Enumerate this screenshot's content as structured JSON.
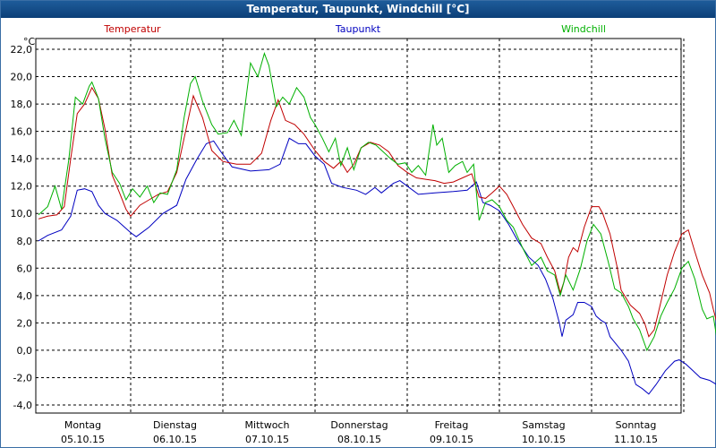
{
  "window": {
    "title": "Temperatur, Taupunkt, Windchill [°C]"
  },
  "chart_data": {
    "type": "line",
    "title": "Temperatur, Taupunkt, Windchill [°C]",
    "unit": "°C",
    "ylim": [
      -4.0,
      22.0
    ],
    "y_ticks": [
      "22,0",
      "20,0",
      "18,0",
      "16,0",
      "14,0",
      "12,0",
      "10,0",
      "8,0",
      "6,0",
      "4,0",
      "2,0",
      "0,0",
      "-2,0",
      "-4,0"
    ],
    "x_range_days": [
      0,
      7.2
    ],
    "x_ticks": [
      {
        "day": "Montag",
        "date": "05.10.15"
      },
      {
        "day": "Dienstag",
        "date": "06.10.15"
      },
      {
        "day": "Mittwoch",
        "date": "07.10.15"
      },
      {
        "day": "Donnerstag",
        "date": "08.10.15"
      },
      {
        "day": "Freitag",
        "date": "09.10.15"
      },
      {
        "day": "Samstag",
        "date": "10.10.15"
      },
      {
        "day": "Sonntag",
        "date": "11.10.15"
      }
    ],
    "grid": true,
    "series": [
      {
        "name": "Taupunkt",
        "color": "#0000c0",
        "points": [
          [
            0,
            8.0
          ],
          [
            0.1,
            8.4
          ],
          [
            0.25,
            8.8
          ],
          [
            0.35,
            9.8
          ],
          [
            0.42,
            11.7
          ],
          [
            0.5,
            11.8
          ],
          [
            0.58,
            11.6
          ],
          [
            0.65,
            10.6
          ],
          [
            0.72,
            10.0
          ],
          [
            0.85,
            9.5
          ],
          [
            1.0,
            8.6
          ],
          [
            1.06,
            8.3
          ],
          [
            1.2,
            9.0
          ],
          [
            1.35,
            10.0
          ],
          [
            1.5,
            10.6
          ],
          [
            1.6,
            12.5
          ],
          [
            1.72,
            14.0
          ],
          [
            1.82,
            15.1
          ],
          [
            1.9,
            15.3
          ],
          [
            1.98,
            14.5
          ],
          [
            2.1,
            13.4
          ],
          [
            2.3,
            13.1
          ],
          [
            2.5,
            13.2
          ],
          [
            2.62,
            13.6
          ],
          [
            2.72,
            15.5
          ],
          [
            2.82,
            15.1
          ],
          [
            2.9,
            15.1
          ],
          [
            3.0,
            14.2
          ],
          [
            3.1,
            13.6
          ],
          [
            3.18,
            12.2
          ],
          [
            3.3,
            11.9
          ],
          [
            3.45,
            11.7
          ],
          [
            3.55,
            11.4
          ],
          [
            3.65,
            11.9
          ],
          [
            3.72,
            11.5
          ],
          [
            3.85,
            12.2
          ],
          [
            3.92,
            12.4
          ],
          [
            4.0,
            12.0
          ],
          [
            4.12,
            11.4
          ],
          [
            4.3,
            11.5
          ],
          [
            4.5,
            11.6
          ],
          [
            4.65,
            11.7
          ],
          [
            4.75,
            12.3
          ],
          [
            4.82,
            10.8
          ],
          [
            4.9,
            10.6
          ],
          [
            5.0,
            10.2
          ],
          [
            5.1,
            9.2
          ],
          [
            5.2,
            8.0
          ],
          [
            5.32,
            6.8
          ],
          [
            5.42,
            6.2
          ],
          [
            5.5,
            5.2
          ],
          [
            5.58,
            3.8
          ],
          [
            5.65,
            2.0
          ],
          [
            5.68,
            1.0
          ],
          [
            5.72,
            2.2
          ],
          [
            5.8,
            2.6
          ],
          [
            5.85,
            3.5
          ],
          [
            5.92,
            3.5
          ],
          [
            6.0,
            3.2
          ],
          [
            6.05,
            2.5
          ],
          [
            6.1,
            2.2
          ],
          [
            6.15,
            2.0
          ],
          [
            6.2,
            1.0
          ],
          [
            6.32,
            0.0
          ],
          [
            6.4,
            -0.8
          ],
          [
            6.48,
            -2.5
          ],
          [
            6.55,
            -2.8
          ],
          [
            6.62,
            -3.2
          ],
          [
            6.7,
            -2.5
          ],
          [
            6.8,
            -1.5
          ],
          [
            6.9,
            -0.8
          ],
          [
            6.95,
            -0.7
          ],
          [
            7.02,
            -1.0
          ],
          [
            7.1,
            -1.5
          ],
          [
            7.18,
            -2.0
          ],
          [
            7.28,
            -2.2
          ],
          [
            7.38,
            -2.6
          ]
        ]
      },
      {
        "name": "Temperatur",
        "color": "#c00000",
        "points": [
          [
            0,
            9.6
          ],
          [
            0.1,
            9.8
          ],
          [
            0.2,
            9.9
          ],
          [
            0.28,
            10.5
          ],
          [
            0.35,
            14.0
          ],
          [
            0.42,
            17.3
          ],
          [
            0.5,
            18.0
          ],
          [
            0.58,
            19.2
          ],
          [
            0.65,
            18.4
          ],
          [
            0.72,
            16.2
          ],
          [
            0.8,
            12.8
          ],
          [
            0.88,
            11.5
          ],
          [
            0.95,
            10.3
          ],
          [
            1.0,
            9.8
          ],
          [
            1.1,
            10.6
          ],
          [
            1.2,
            11.0
          ],
          [
            1.3,
            11.4
          ],
          [
            1.4,
            11.6
          ],
          [
            1.5,
            13.0
          ],
          [
            1.58,
            15.5
          ],
          [
            1.68,
            18.6
          ],
          [
            1.78,
            17.0
          ],
          [
            1.88,
            14.6
          ],
          [
            2.0,
            13.8
          ],
          [
            2.15,
            13.6
          ],
          [
            2.3,
            13.6
          ],
          [
            2.42,
            14.4
          ],
          [
            2.52,
            16.8
          ],
          [
            2.6,
            18.3
          ],
          [
            2.68,
            16.8
          ],
          [
            2.78,
            16.5
          ],
          [
            2.88,
            15.8
          ],
          [
            3.0,
            14.6
          ],
          [
            3.1,
            13.8
          ],
          [
            3.2,
            13.3
          ],
          [
            3.28,
            13.8
          ],
          [
            3.35,
            13.0
          ],
          [
            3.42,
            13.6
          ],
          [
            3.5,
            14.8
          ],
          [
            3.6,
            15.2
          ],
          [
            3.7,
            15.0
          ],
          [
            3.8,
            14.5
          ],
          [
            3.9,
            13.5
          ],
          [
            4.0,
            13.0
          ],
          [
            4.1,
            12.6
          ],
          [
            4.2,
            12.5
          ],
          [
            4.3,
            12.4
          ],
          [
            4.4,
            12.2
          ],
          [
            4.5,
            12.3
          ],
          [
            4.6,
            12.6
          ],
          [
            4.7,
            12.9
          ],
          [
            4.78,
            11.2
          ],
          [
            4.85,
            11.1
          ],
          [
            4.92,
            11.5
          ],
          [
            5.0,
            12.0
          ],
          [
            5.08,
            11.4
          ],
          [
            5.15,
            10.5
          ],
          [
            5.25,
            9.2
          ],
          [
            5.35,
            8.2
          ],
          [
            5.45,
            7.8
          ],
          [
            5.52,
            6.8
          ],
          [
            5.6,
            5.8
          ],
          [
            5.66,
            4.2
          ],
          [
            5.7,
            5.0
          ],
          [
            5.75,
            6.8
          ],
          [
            5.8,
            7.5
          ],
          [
            5.85,
            7.2
          ],
          [
            5.92,
            9.0
          ],
          [
            6.0,
            10.5
          ],
          [
            6.08,
            10.5
          ],
          [
            6.12,
            10.0
          ],
          [
            6.2,
            8.5
          ],
          [
            6.28,
            6.0
          ],
          [
            6.32,
            4.4
          ],
          [
            6.42,
            3.3
          ],
          [
            6.52,
            2.7
          ],
          [
            6.58,
            1.9
          ],
          [
            6.62,
            1.0
          ],
          [
            6.68,
            1.5
          ],
          [
            6.75,
            3.5
          ],
          [
            6.82,
            5.5
          ],
          [
            6.9,
            7.2
          ],
          [
            6.98,
            8.5
          ],
          [
            7.05,
            8.8
          ],
          [
            7.12,
            7.2
          ],
          [
            7.2,
            5.5
          ],
          [
            7.28,
            4.2
          ],
          [
            7.32,
            3.0
          ],
          [
            7.38,
            1.5
          ]
        ]
      },
      {
        "name": "Windchill",
        "color": "#00b000",
        "points": [
          [
            0,
            9.9
          ],
          [
            0.1,
            10.5
          ],
          [
            0.18,
            12.0
          ],
          [
            0.25,
            10.3
          ],
          [
            0.33,
            14.0
          ],
          [
            0.4,
            18.5
          ],
          [
            0.48,
            18.0
          ],
          [
            0.55,
            19.3
          ],
          [
            0.58,
            19.6
          ],
          [
            0.65,
            18.4
          ],
          [
            0.72,
            15.5
          ],
          [
            0.8,
            13.0
          ],
          [
            0.88,
            12.2
          ],
          [
            0.95,
            11.0
          ],
          [
            1.02,
            11.8
          ],
          [
            1.1,
            11.2
          ],
          [
            1.18,
            12.0
          ],
          [
            1.25,
            10.8
          ],
          [
            1.32,
            11.5
          ],
          [
            1.4,
            11.4
          ],
          [
            1.5,
            13.2
          ],
          [
            1.58,
            17.0
          ],
          [
            1.65,
            19.5
          ],
          [
            1.7,
            20.0
          ],
          [
            1.78,
            18.2
          ],
          [
            1.88,
            16.5
          ],
          [
            1.95,
            15.8
          ],
          [
            2.05,
            15.9
          ],
          [
            2.12,
            16.8
          ],
          [
            2.2,
            15.7
          ],
          [
            2.3,
            21.0
          ],
          [
            2.38,
            20.0
          ],
          [
            2.45,
            21.7
          ],
          [
            2.5,
            20.8
          ],
          [
            2.58,
            17.8
          ],
          [
            2.65,
            18.5
          ],
          [
            2.72,
            18.0
          ],
          [
            2.8,
            19.2
          ],
          [
            2.88,
            18.5
          ],
          [
            2.95,
            17.0
          ],
          [
            3.0,
            16.5
          ],
          [
            3.08,
            15.5
          ],
          [
            3.15,
            14.5
          ],
          [
            3.22,
            15.5
          ],
          [
            3.28,
            13.5
          ],
          [
            3.35,
            14.8
          ],
          [
            3.42,
            13.2
          ],
          [
            3.5,
            14.8
          ],
          [
            3.58,
            15.2
          ],
          [
            3.66,
            15.0
          ],
          [
            3.74,
            14.5
          ],
          [
            3.82,
            14.0
          ],
          [
            3.9,
            13.6
          ],
          [
            3.98,
            13.7
          ],
          [
            4.05,
            13.0
          ],
          [
            4.12,
            13.5
          ],
          [
            4.2,
            12.8
          ],
          [
            4.28,
            16.5
          ],
          [
            4.32,
            15.0
          ],
          [
            4.38,
            15.5
          ],
          [
            4.45,
            13.0
          ],
          [
            4.52,
            13.5
          ],
          [
            4.6,
            13.8
          ],
          [
            4.65,
            13.0
          ],
          [
            4.72,
            13.6
          ],
          [
            4.78,
            9.5
          ],
          [
            4.85,
            10.8
          ],
          [
            4.92,
            11.0
          ],
          [
            5.0,
            10.5
          ],
          [
            5.08,
            9.5
          ],
          [
            5.15,
            9.0
          ],
          [
            5.25,
            7.5
          ],
          [
            5.35,
            6.2
          ],
          [
            5.45,
            6.8
          ],
          [
            5.52,
            5.8
          ],
          [
            5.6,
            5.5
          ],
          [
            5.66,
            4.0
          ],
          [
            5.72,
            5.5
          ],
          [
            5.8,
            4.4
          ],
          [
            5.88,
            6.0
          ],
          [
            5.95,
            8.0
          ],
          [
            6.02,
            9.2
          ],
          [
            6.1,
            8.5
          ],
          [
            6.18,
            6.5
          ],
          [
            6.25,
            4.5
          ],
          [
            6.32,
            4.2
          ],
          [
            6.4,
            3.2
          ],
          [
            6.45,
            2.3
          ],
          [
            6.52,
            1.5
          ],
          [
            6.6,
            0.0
          ],
          [
            6.68,
            1.0
          ],
          [
            6.75,
            2.5
          ],
          [
            6.82,
            3.5
          ],
          [
            6.9,
            4.5
          ],
          [
            6.98,
            6.0
          ],
          [
            7.05,
            6.5
          ],
          [
            7.12,
            5.2
          ],
          [
            7.2,
            3.0
          ],
          [
            7.25,
            2.3
          ],
          [
            7.32,
            2.5
          ],
          [
            7.38,
            0.0
          ]
        ]
      }
    ]
  }
}
